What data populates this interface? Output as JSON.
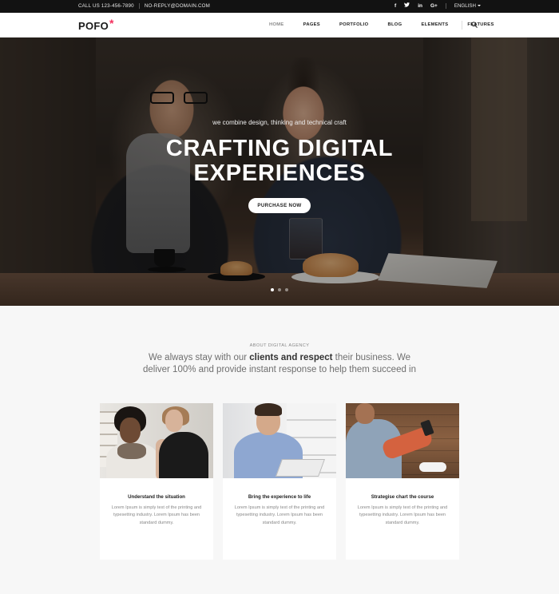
{
  "topbar": {
    "call": "CALL US 123-456-7890",
    "email": "NO-REPLY@DOMAIN.COM",
    "social": [
      "f",
      "t",
      "in",
      "G+"
    ],
    "language": "ENGLISH"
  },
  "header": {
    "logo": "POFO",
    "logo_mark": "*",
    "nav": [
      "HOME",
      "PAGES",
      "PORTFOLIO",
      "BLOG",
      "ELEMENTS",
      "FEATURES"
    ],
    "active_nav": "HOME",
    "search_icon": "search-icon"
  },
  "hero": {
    "subtitle": "we combine design, thinking and technical craft",
    "title_line1": "CRAFTING DIGITAL",
    "title_line2": "EXPERIENCES",
    "cta": "PURCHASE NOW",
    "slides": 3,
    "active_slide": 1
  },
  "about": {
    "label": "ABOUT DIGITAL AGENCY",
    "text_pre": "We always stay with our ",
    "text_bold": "clients and respect",
    "text_post": " their business. We deliver 100% and provide instant response to help them succeed in"
  },
  "cards": [
    {
      "title": "Understand the situation",
      "desc": "Lorem Ipsum is simply text of the printing and typesetting industry. Lorem Ipsum has been standard dummy."
    },
    {
      "title": "Bring the experience to life",
      "desc": "Lorem Ipsum is simply text of the printing and typesetting industry. Lorem Ipsum has been standard dummy."
    },
    {
      "title": "Strategise chart the course",
      "desc": "Lorem Ipsum is simply text of the printing and typesetting industry. Lorem Ipsum has been standard dummy."
    }
  ],
  "colors": {
    "accent": "#f3305d",
    "topbar_bg": "#121212",
    "page_bg": "#f7f7f7"
  }
}
